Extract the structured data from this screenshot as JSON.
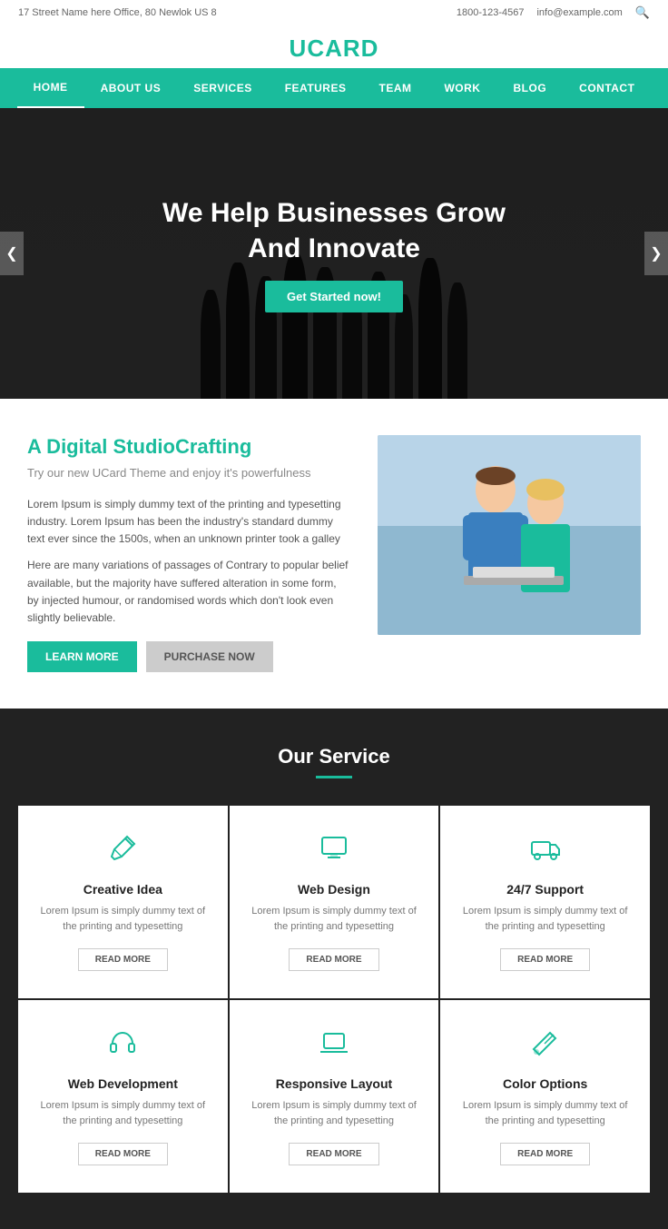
{
  "topbar": {
    "address": "17 Street Name here Office, 80 Newlok US 8",
    "phone": "1800-123-4567",
    "email": "info@example.com"
  },
  "logo": {
    "prefix": "U",
    "suffix": "CARD"
  },
  "nav": {
    "items": [
      {
        "label": "HOME",
        "active": true
      },
      {
        "label": "ABOUT US",
        "active": false
      },
      {
        "label": "SERVICES",
        "active": false
      },
      {
        "label": "FEATURES",
        "active": false
      },
      {
        "label": "TEAM",
        "active": false
      },
      {
        "label": "WORK",
        "active": false
      },
      {
        "label": "BLOG",
        "active": false
      },
      {
        "label": "CONTACT",
        "active": false
      }
    ]
  },
  "hero": {
    "headline1": "We Help Businesses Grow",
    "headline2": "And Innovate",
    "cta": "Get Started now!",
    "prev": "❮",
    "next": "❯"
  },
  "about": {
    "title_plain": "A Digital Studio",
    "title_accent": "Crafting",
    "subtitle": "Try our new UCard Theme and enjoy it's powerfulness",
    "para1": "Lorem Ipsum is simply dummy text of the printing and typesetting industry. Lorem Ipsum has been the industry's standard dummy text ever since the 1500s, when an unknown printer took a galley",
    "para2": "Here are many variations of passages of Contrary to popular belief available, but the majority have suffered alteration in some form, by injected humour, or randomised words which don't look even slightly believable.",
    "btn_learn": "LEARN MORE",
    "btn_purchase": "PURCHASE NOW"
  },
  "services": {
    "title": "Our Service",
    "items": [
      {
        "icon": "✏️",
        "name": "Creative Idea",
        "desc": "Lorem Ipsum is simply dummy text of the printing and typesetting",
        "btn": "READ MORE"
      },
      {
        "icon": "🖥️",
        "name": "Web Design",
        "desc": "Lorem Ipsum is simply dummy text of the printing and typesetting",
        "btn": "READ MORE"
      },
      {
        "icon": "🚚",
        "name": "24/7 Support",
        "desc": "Lorem Ipsum is simply dummy text of the printing and typesetting",
        "btn": "READ MORE"
      },
      {
        "icon": "🎧",
        "name": "Web Development",
        "desc": "Lorem Ipsum is simply dummy text of the printing and typesetting",
        "btn": "READ MORE"
      },
      {
        "icon": "💻",
        "name": "Responsive Layout",
        "desc": "Lorem Ipsum is simply dummy text of the printing and typesetting",
        "btn": "READ MORE"
      },
      {
        "icon": "🎨",
        "name": "Color Options",
        "desc": "Lorem Ipsum is simply dummy text of the printing and typesetting",
        "btn": "READ MORE"
      }
    ]
  }
}
